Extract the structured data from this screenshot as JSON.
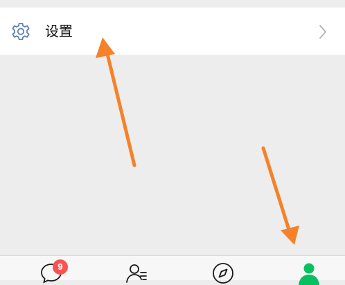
{
  "settings": {
    "label": "设置"
  },
  "tabbar": {
    "tabs": [
      {
        "icon": "chat-icon",
        "badge": "9",
        "active": false
      },
      {
        "icon": "contacts-icon",
        "active": false
      },
      {
        "icon": "discover-compass-icon",
        "active": false
      },
      {
        "icon": "me-profile-icon",
        "active": true
      }
    ]
  },
  "colors": {
    "page_background": "#ededed",
    "row_background": "#ffffff",
    "icon_blue": "#5b7fb5",
    "badge_red": "#fa5151",
    "active_green": "#07c160",
    "annotation_orange": "#f5822a"
  }
}
